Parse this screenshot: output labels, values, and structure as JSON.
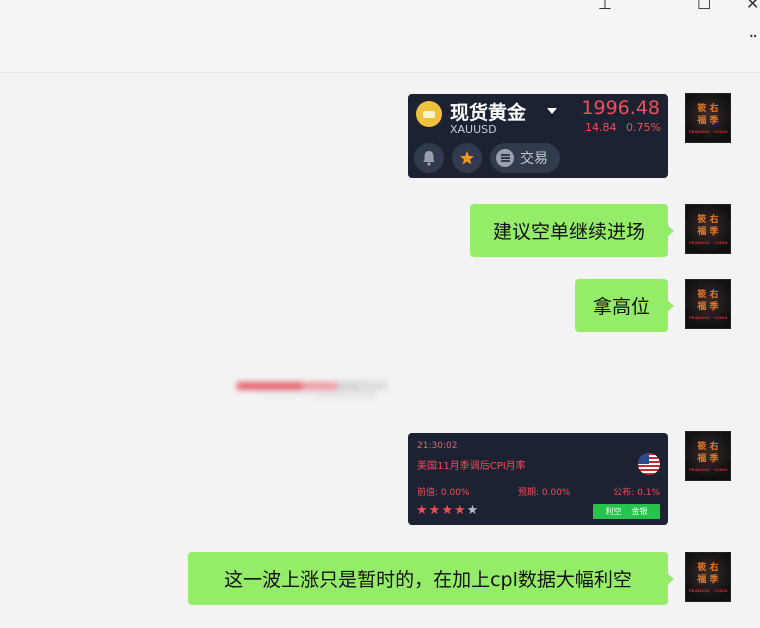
{
  "window": {
    "pin_glyph": "⊥",
    "maximize_glyph": "☐",
    "close_glyph": "✕",
    "more_glyph": "··"
  },
  "messages": {
    "quote_card": {
      "name": "现货黄金",
      "symbol": "XAUUSD",
      "price": "1996.48",
      "change": "14.84",
      "change_pct": "0.75%",
      "trade_label": "交易",
      "up_color": "#ef4d59"
    },
    "bubble1": "建议空单继续进场",
    "bubble2": "拿高位",
    "econ_card": {
      "time": "21:30:02",
      "title": "美国11月季调后CPI月率",
      "previous": "前值: 0.00%",
      "forecast": "预期: 0.00%",
      "actual": "公布: 0.1%",
      "stars_filled": 4,
      "stars_total": 5,
      "impact_left": "利空",
      "impact_right": "金银"
    },
    "bubble3": "这一波上涨只是暂时的，在加上cpl数据大幅利空"
  },
  "avatar": {
    "line1": "筱 右",
    "line2": "福 季",
    "seal": "TRADING · GOLD"
  }
}
